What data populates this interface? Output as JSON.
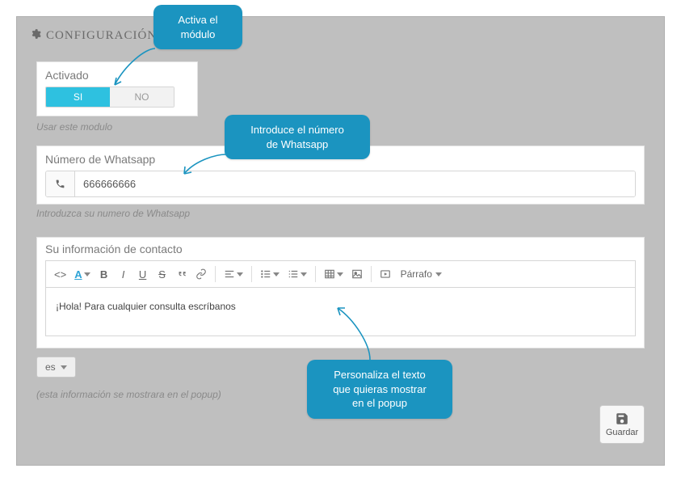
{
  "header": {
    "title": "CONFIGURACIÓN"
  },
  "activate": {
    "label": "Activado",
    "on": "SI",
    "off": "NO",
    "hint": "Usar este modulo"
  },
  "phone": {
    "label": "Número de Whatsapp",
    "value": "666666666",
    "hint": "Introduzca su numero de Whatsapp"
  },
  "editor": {
    "label": "Su información de contacto",
    "content": "¡Hola! Para cualquier consulta escríbanos",
    "paragraph_label": "Párrafo"
  },
  "lang": {
    "label": "es"
  },
  "popup_hint": "(esta información se mostrara en el popup)",
  "save": {
    "label": "Guardar"
  },
  "callouts": {
    "c1": "Activa el\nmódulo",
    "c2": "Introduce el número\nde Whatsapp",
    "c3": "Personaliza el texto\nque quieras mostrar\nen el popup"
  }
}
